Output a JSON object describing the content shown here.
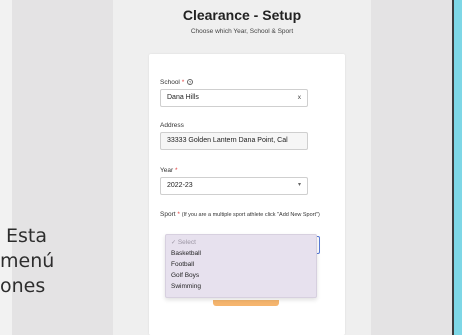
{
  "side_text": [
    "Esta",
    "menú",
    "ones"
  ],
  "page": {
    "title": "Clearance - Setup",
    "subtitle": "Choose which Year, School & Sport"
  },
  "form": {
    "school": {
      "label": "School",
      "required_mark": "*",
      "help_icon": "question-circle-icon",
      "value": "Dana Hills",
      "clear": "x"
    },
    "address": {
      "label": "Address",
      "value": "33333 Golden Lantern Dana Point, Cal"
    },
    "year": {
      "label": "Year",
      "required_mark": "*",
      "value": "2022-23",
      "chevron": "▾"
    },
    "sport": {
      "label": "Sport",
      "required_mark": "*",
      "hint": "(If you are a multiple sport athlete click \"Add New Sport\")",
      "options": [
        "Select",
        "Basketball",
        "Football",
        "Golf Boys",
        "Swimming"
      ],
      "selected_marker": "✓"
    }
  },
  "colors": {
    "accent_button": "#f5b56e",
    "required": "#e03a3a",
    "dropdown_bg": "#e7e1ee",
    "right_strip": "#7ed7e6"
  }
}
